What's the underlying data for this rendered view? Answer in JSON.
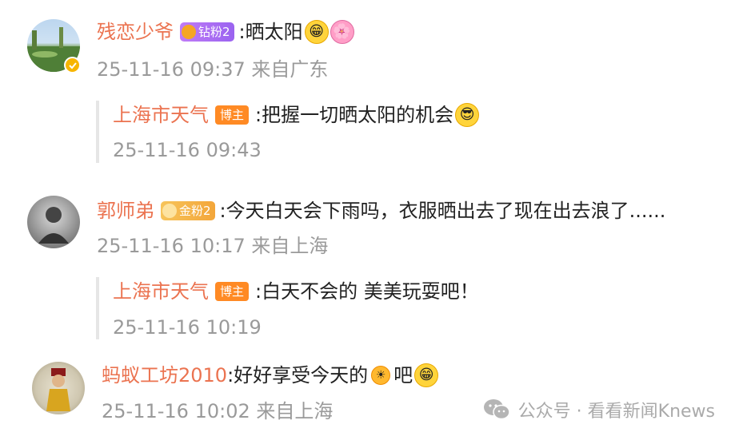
{
  "comments": [
    {
      "user": "残恋少爷",
      "fan_badge": "钻粉2",
      "separator": ":",
      "text": "晒太阳",
      "emojis": [
        "grin-emoji",
        "flower-emoji"
      ],
      "time": "25-11-16 09:37 来自广东",
      "verified": true,
      "reply": {
        "user": "上海市天气",
        "host_badge": "博主",
        "separator": ":",
        "text": "把握一切晒太阳的机会",
        "emojis": [
          "sunglasses-emoji"
        ],
        "time": "25-11-16 09:43"
      }
    },
    {
      "user": "郭师弟",
      "fan_badge": "金粉2",
      "separator": ":",
      "text": "今天白天会下雨吗，衣服晒出去了现在出去浪了......",
      "time": "25-11-16 10:17 来自上海",
      "reply": {
        "user": "上海市天气",
        "host_badge": "博主",
        "separator": ":",
        "text": "白天不会的 美美玩耍吧！",
        "time": "25-11-16 10:19"
      }
    },
    {
      "user": "蚂蚁工坊2010",
      "separator": ":",
      "text_before": "好好享受今天的",
      "text_after": "吧",
      "emojis": [
        "sun-emoji",
        "grin-emoji"
      ],
      "time": "25-11-16 10:02 来自上海"
    }
  ],
  "watermark": "公众号 · 看看新闻Knews",
  "colors": {
    "username": "#eb7350",
    "meta": "#9a9a9a",
    "host_badge": "#ff8a24",
    "diamond_badge": "#a66cf3",
    "gold_badge": "#f3a63a"
  }
}
